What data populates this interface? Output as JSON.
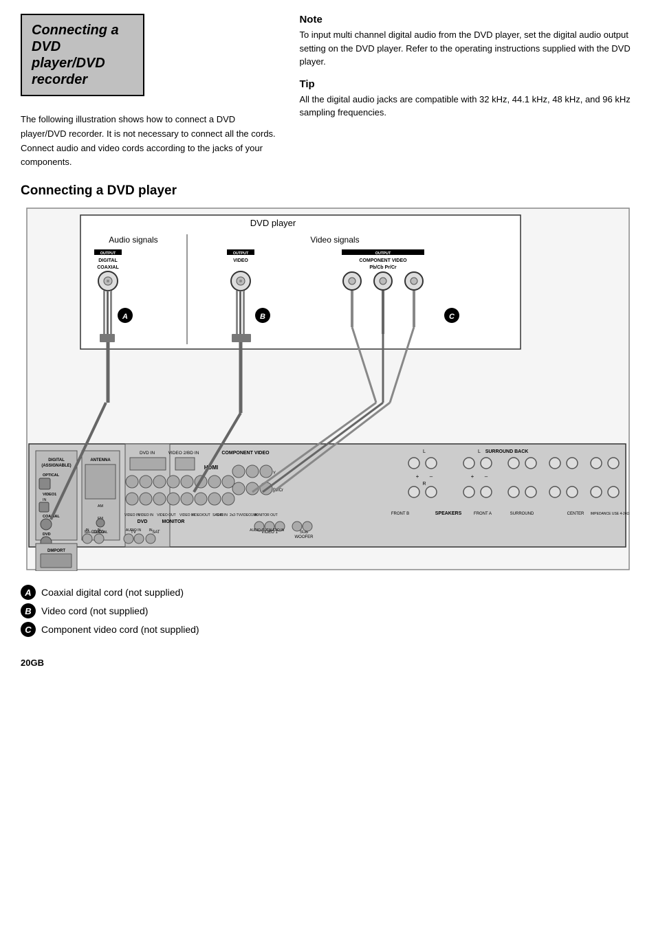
{
  "page": {
    "title": "Connecting a DVD player/DVD recorder",
    "body_text": "The following illustration shows how to connect a DVD player/DVD recorder. It is not necessary to connect all the cords. Connect audio and video cords according to the jacks of your components.",
    "note_title": "Note",
    "note_text": "To input multi channel digital audio from the DVD player, set the digital audio output setting on the DVD player. Refer to the operating instructions supplied with the DVD player.",
    "tip_title": "Tip",
    "tip_text": "All the digital audio jacks are compatible with 32 kHz, 44.1 kHz, 48 kHz, and 96 kHz sampling frequencies.",
    "section_title": "Connecting a DVD player",
    "dvd_player_label": "DVD player",
    "audio_signals_label": "Audio signals",
    "video_signals_label": "Video signals",
    "output_digital_coaxial": "OUTPUT\nDIGITAL\nCOAXIAL",
    "output_video": "OUTPUT\nVIDEO",
    "output_component_video": "OUTPUT\nCOMPONENT VIDEO\nPb/Cb  Pr/Cr",
    "legend": [
      {
        "id": "A",
        "text": "Coaxial digital cord (not supplied)"
      },
      {
        "id": "B",
        "text": "Video cord (not supplied)"
      },
      {
        "id": "C",
        "text": "Component video cord (not supplied)"
      }
    ],
    "page_number": "20GB",
    "antenna_label": "ANTENNA",
    "hdmi_label": "HDMI",
    "dvd_label": "DVD",
    "tv_label": "TV",
    "sat_label": "SAT",
    "video1_label": "VIDEO 1",
    "sub_woofer_label": "SUB\nWOOFER",
    "monitor_label": "MONITOR",
    "component_video_label": "COMPONENT VIDEO",
    "speakers_label": "SPEAKERS",
    "surround_back_label": "SURROUND BACK",
    "surround_label": "SURROUND",
    "center_label": "CENTER",
    "front_a_label": "FRONT A",
    "front_b_label": "FRONT B",
    "dmport_label": "DMPORT",
    "digital_assignable_label": "DIGITAL\n(ASSIGNABLE)",
    "sa_cd_label": "SA-CD/CD",
    "impedance_label": "IMPEDANCE USE 4-24Ω"
  }
}
